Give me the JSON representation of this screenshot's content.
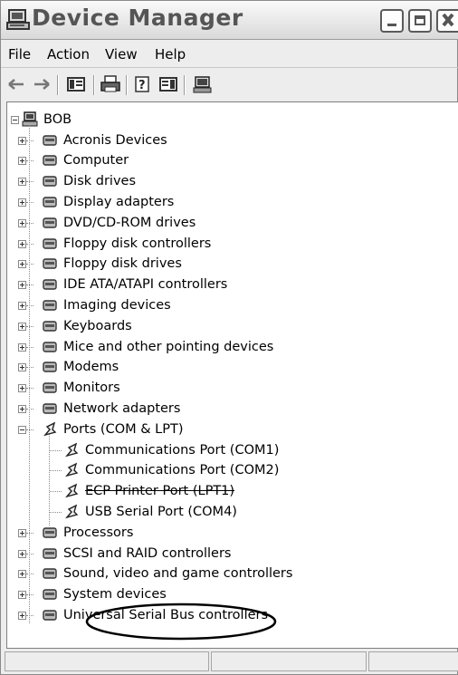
{
  "window": {
    "title": "Device Manager"
  },
  "menu": [
    {
      "label": "File"
    },
    {
      "label": "Action"
    },
    {
      "label": "View"
    },
    {
      "label": "Help"
    }
  ],
  "toolbar": {
    "icons": [
      "back-icon",
      "forward-icon",
      "show-hide-console-tree-icon",
      "print-icon",
      "properties-icon",
      "help-icon",
      "scan-hardware-icon"
    ]
  },
  "tree": {
    "root": "BOB",
    "categories": [
      {
        "label": "Acronis Devices",
        "icon": "acronis-devices-icon"
      },
      {
        "label": "Computer",
        "icon": "computer-icon"
      },
      {
        "label": "Disk drives",
        "icon": "disk-drive-icon"
      },
      {
        "label": "Display adapters",
        "icon": "display-adapter-icon"
      },
      {
        "label": "DVD/CD-ROM drives",
        "icon": "dvd-drive-icon"
      },
      {
        "label": "Floppy disk controllers",
        "icon": "floppy-controller-icon"
      },
      {
        "label": "Floppy disk drives",
        "icon": "floppy-drive-icon"
      },
      {
        "label": "IDE ATA/ATAPI controllers",
        "icon": "ide-controller-icon"
      },
      {
        "label": "Imaging devices",
        "icon": "imaging-device-icon"
      },
      {
        "label": "Keyboards",
        "icon": "keyboard-icon"
      },
      {
        "label": "Mice and other pointing devices",
        "icon": "mouse-icon"
      },
      {
        "label": "Modems",
        "icon": "modem-icon"
      },
      {
        "label": "Monitors",
        "icon": "monitor-icon"
      },
      {
        "label": "Network adapters",
        "icon": "network-adapter-icon"
      },
      {
        "label": "Ports (COM & LPT)",
        "icon": "port-icon",
        "expanded": true
      }
    ],
    "ports": [
      {
        "label": "Communications Port (COM1)"
      },
      {
        "label": "Communications Port (COM2)"
      },
      {
        "label": "ECP Printer Port (LPT1)"
      },
      {
        "label": "USB Serial Port (COM4)"
      }
    ],
    "categories_after": [
      {
        "label": "Processors",
        "icon": "processor-icon"
      },
      {
        "label": "SCSI and RAID controllers",
        "icon": "scsi-controller-icon"
      },
      {
        "label": "Sound, video and game controllers",
        "icon": "sound-icon"
      },
      {
        "label": "System devices",
        "icon": "system-device-icon"
      },
      {
        "label": "Universal Serial Bus controllers",
        "icon": "usb-icon"
      }
    ]
  }
}
